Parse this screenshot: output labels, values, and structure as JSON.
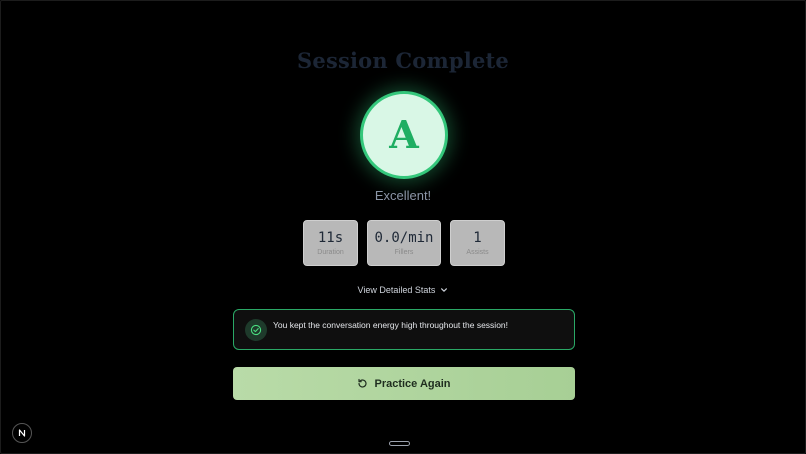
{
  "session": {
    "title": "Session Complete",
    "grade_letter": "A",
    "grade_label": "Excellent!"
  },
  "stats": [
    {
      "value": "11s",
      "label": "Duration"
    },
    {
      "value": "0.0/min",
      "label": "Fillers"
    },
    {
      "value": "1",
      "label": "Assists"
    }
  ],
  "details": {
    "toggle_label": "View Detailed Stats",
    "icon": "chevron-down-icon"
  },
  "feedback": {
    "text": "You kept the conversation energy high throughout the session!",
    "icon": "check-circle-icon"
  },
  "actions": {
    "practice_again_label": "Practice Again",
    "icon": "refresh-icon"
  },
  "colors": {
    "accent_green": "#34c77b",
    "button_green": "#b9dba8"
  }
}
